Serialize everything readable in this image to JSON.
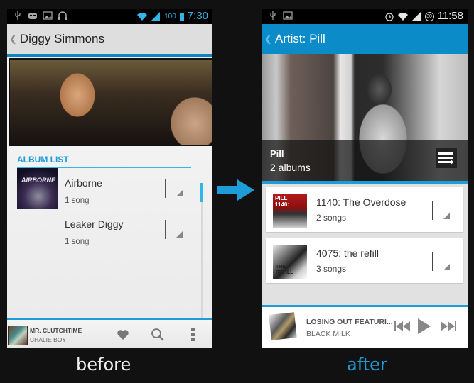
{
  "before": {
    "status_bar": {
      "icons_left": [
        "usb-icon",
        "cyanogen-icon",
        "image-icon",
        "headphones-icon"
      ],
      "icons_right": [
        "wifi-icon",
        "signal-icon"
      ],
      "battery": "100",
      "time": "7:30"
    },
    "action_bar": {
      "back_icon": "chevron-left-icon",
      "title": "Diggy Simmons"
    },
    "album_list": {
      "heading": "ALBUM LIST",
      "items": [
        {
          "title": "Airborne",
          "subtitle": "1 song",
          "has_art": true
        },
        {
          "title": "Leaker Diggy",
          "subtitle": "1 song",
          "has_art": false
        }
      ]
    },
    "now_playing": {
      "title": "MR. CLUTCHTIME",
      "artist": "CHALIE BOY",
      "actions": [
        "heart-icon",
        "search-icon",
        "overflow-menu-icon"
      ]
    },
    "caption": "before"
  },
  "after": {
    "status_bar": {
      "icons_left": [
        "usb-icon",
        "image-icon"
      ],
      "icons_right": [
        "alarm-icon",
        "wifi-icon",
        "signal-icon"
      ],
      "battery": "30",
      "time": "11:58"
    },
    "action_bar": {
      "back_icon": "chevron-left-icon",
      "title": "Artist: Pill"
    },
    "artist_header": {
      "name": "Pill",
      "album_count": "2 albums",
      "queue_icon": "queue-list-icon"
    },
    "albums": [
      {
        "title": "1140: The Overdose",
        "subtitle": "2 songs"
      },
      {
        "title": "4075: the refill",
        "subtitle": "3 songs"
      }
    ],
    "now_playing": {
      "title": "LOSING OUT FEATURI...",
      "artist": "BLACK MILK",
      "controls": [
        "previous-icon",
        "play-icon",
        "next-icon"
      ]
    },
    "caption": "after"
  },
  "colors": {
    "accent": "#33b5e5",
    "accent_dark": "#0b8cc8",
    "background": "#111111"
  }
}
